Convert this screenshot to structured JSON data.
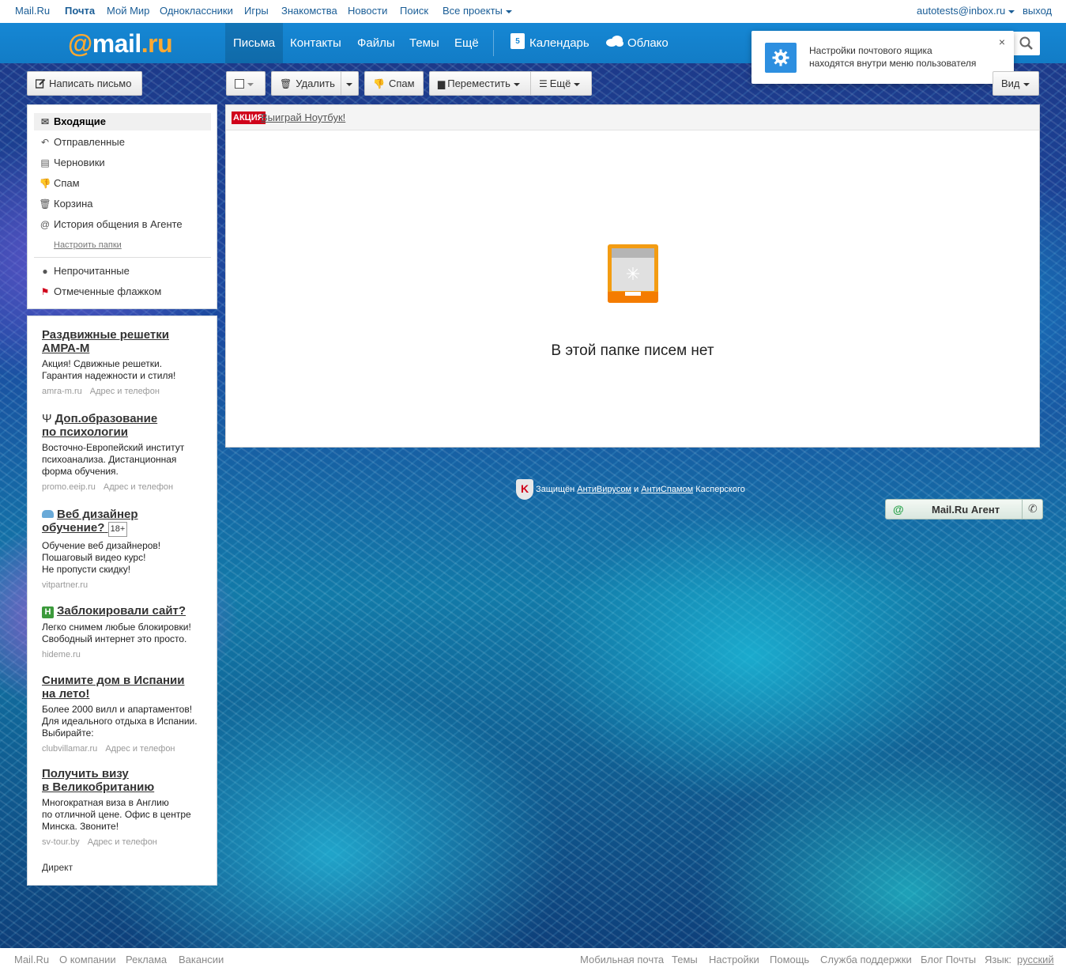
{
  "portal": {
    "links": [
      "Mail.Ru",
      "Почта",
      "Мой Мир",
      "Одноклассники",
      "Игры",
      "Знакомства",
      "Новости",
      "Поиск",
      "Все проекты"
    ],
    "user": "autotests@inbox.ru",
    "logout": "выход"
  },
  "header": {
    "logo_at": "@",
    "logo_mail": "mail",
    "logo_ru": ".ru",
    "nav": [
      "Письма",
      "Контакты",
      "Файлы",
      "Темы",
      "Ещё"
    ],
    "calendar": "Календарь",
    "calendar_day": "5",
    "cloud": "Облако"
  },
  "notification": {
    "text_line1": "Настройки почтового ящика",
    "text_line2": "находятся внутри меню пользователя",
    "close": "×"
  },
  "toolbar": {
    "compose": "Написать письмо",
    "delete": "Удалить",
    "spam": "Спам",
    "move": "Переместить",
    "more": "Ещё",
    "view": "Вид"
  },
  "folders": {
    "items": [
      "Входящие",
      "Отправленные",
      "Черновики",
      "Спам",
      "Корзина",
      "История общения в Агенте"
    ],
    "configure": "Настроить папки",
    "filters": [
      "Непрочитанные",
      "Отмеченные флажком"
    ]
  },
  "ads": [
    {
      "title_1": "Раздвижные решетки",
      "title_2": "АМРА-М",
      "text": [
        "Акция! Сдвижные решетки.",
        "Гарантия надежности и стиля!"
      ],
      "domain": "amra-m.ru",
      "address": "Адрес и телефон"
    },
    {
      "title_1": "Доп.образование",
      "title_2": "по психологии",
      "text": [
        "Восточно-Европейский институт",
        "психоанализа. Дистанционная",
        "форма обучения."
      ],
      "domain": "promo.eeip.ru",
      "address": "Адрес и телефон"
    },
    {
      "title_1": "Веб дизайнер",
      "title_2": "обучение?",
      "age": "18+",
      "text": [
        "Обучение веб дизайнеров!",
        "Пошаговый видео курс!",
        "Не пропусти скидку!"
      ],
      "domain": "vitpartner.ru"
    },
    {
      "title_1": "Заблокировали сайт?",
      "text": [
        "Легко снимем любые блокировки!",
        "Свободный интернет это просто."
      ],
      "domain": "hideme.ru"
    },
    {
      "title_1": "Снимите дом в Испании",
      "title_2": "на лето!",
      "text": [
        "Более 2000 вилл и апартаментов!",
        "Для идеального отдыха в Испании.",
        "Выбирайте:"
      ],
      "domain": "clubvillamar.ru",
      "address": "Адрес и телефон"
    },
    {
      "title_1": "Получить визу",
      "title_2": "в Великобританию",
      "text": [
        "Многократная виза в Англию",
        "по отличной цене. Офис в центре",
        "Минска. Звоните!"
      ],
      "domain": "sv-tour.by",
      "address": "Адрес и телефон"
    }
  ],
  "direct": "Директ",
  "promo": {
    "badge": "АКЦИЯ",
    "link": "Выиграй Ноутбук!"
  },
  "empty_text": "В этой папке писем нет",
  "kaspersky": {
    "prefix": "Защищён",
    "antivirus": "АнтиВирусом",
    "and": "и",
    "antispam": "АнтиСпамом",
    "suffix": "Касперского"
  },
  "agent": {
    "label": "Mail.Ru Агент"
  },
  "footer": {
    "left": [
      "Mail.Ru",
      "О компании",
      "Реклама",
      "Вакансии"
    ],
    "right": [
      "Мобильная почта",
      "Темы",
      "Настройки",
      "Помощь",
      "Служба поддержки",
      "Блог Почты",
      "Язык:",
      "русский"
    ]
  },
  "colors": {
    "header": "#1687d4",
    "accent": "#ffa930",
    "link": "#1a5d96"
  }
}
